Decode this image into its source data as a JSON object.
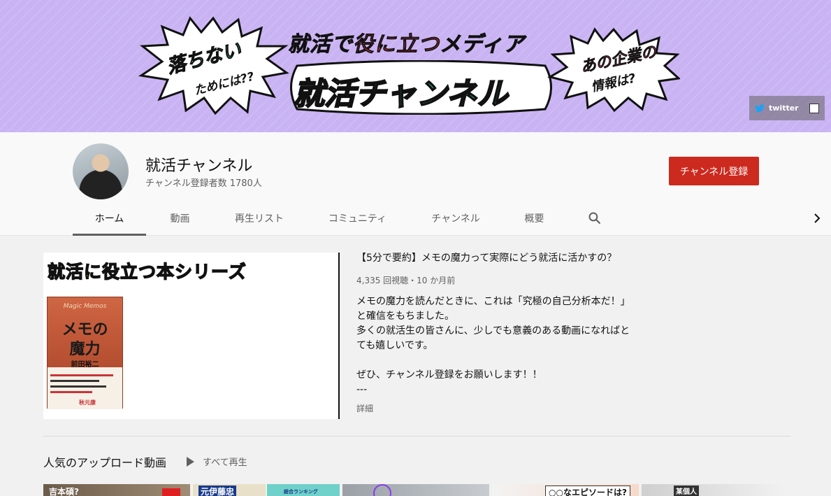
{
  "banner": {
    "bubble_left_line1": "落ちない",
    "bubble_left_line2": "ためには??",
    "tagline_pre": "就活で",
    "tagline_highlight": "役に立つ",
    "tagline_post": "メディア",
    "main_title": "就活チャンネル",
    "bubble_right_line1": "あの企業の",
    "bubble_right_line2": "情報は?",
    "link_twitter": "twitter"
  },
  "channel": {
    "name": "就活チャンネル",
    "subscribers": "チャンネル登録者数 1780人",
    "subscribe_label": "チャンネル登録"
  },
  "tabs": [
    {
      "label": "ホーム"
    },
    {
      "label": "動画"
    },
    {
      "label": "再生リスト"
    },
    {
      "label": "コミュニティ"
    },
    {
      "label": "チャンネル"
    },
    {
      "label": "概要"
    }
  ],
  "featured": {
    "thumb_title": "就活に役立つ本シリーズ",
    "book_en": "Magic Memos",
    "book_title_1": "メモの",
    "book_title_2": "魔力",
    "book_author": "前田裕二",
    "book_sig": "秋元康",
    "title": "【5分で要約】メモの魔力って実際にどう就活に活かすの？",
    "meta": "4,335 回視聴・10 か月前",
    "desc": [
      "メモの魔力を読んだときに、これは「究極の自己分析本だ！」",
      "と確信をもちました。",
      "多くの就活生の皆さんに、少しでも意義のある動画になればと",
      "ても嬉しいです。",
      "",
      "ぜひ、チャンネル登録をお願いします！！",
      "---"
    ],
    "more": "詳細"
  },
  "shelf": {
    "title": "人気のアップロード動画",
    "play_all": "すべて再生",
    "thumbs": [
      {
        "label": "吉本碩?"
      },
      {
        "label": "元伊藤忠"
      },
      {
        "label": "総合ランキング"
      },
      {
        "label": ""
      },
      {
        "label": "○○なエピソードは?"
      },
      {
        "label": "某個人"
      }
    ]
  },
  "colors": {
    "banner_bg": "#c9b3f3",
    "subscribe_btn": "#cc2a1f",
    "accent_green": "#39d4a8",
    "accent_yellow": "#f5c400"
  }
}
